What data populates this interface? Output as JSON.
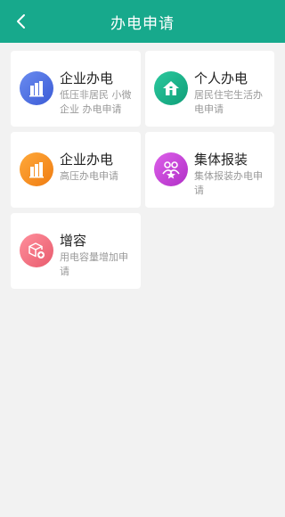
{
  "header": {
    "title": "办电申请"
  },
  "cards": [
    {
      "title": "企业办电",
      "desc": "低压非居民 小微企业 办电申请",
      "icon": "building-icon",
      "color": "#4a6ee0"
    },
    {
      "title": "个人办电",
      "desc": "居民住宅生活办电申请",
      "icon": "home-icon",
      "color": "#17b38a"
    },
    {
      "title": "企业办电",
      "desc": "高压办电申请",
      "icon": "building-icon",
      "color": "#f39320"
    },
    {
      "title": "集体报装",
      "desc": "集体报装办电申请",
      "icon": "group-icon",
      "color": "#c944d8"
    },
    {
      "title": "增容",
      "desc": "用电容量增加申请",
      "icon": "box-plus-icon",
      "color": "#f07081"
    }
  ]
}
